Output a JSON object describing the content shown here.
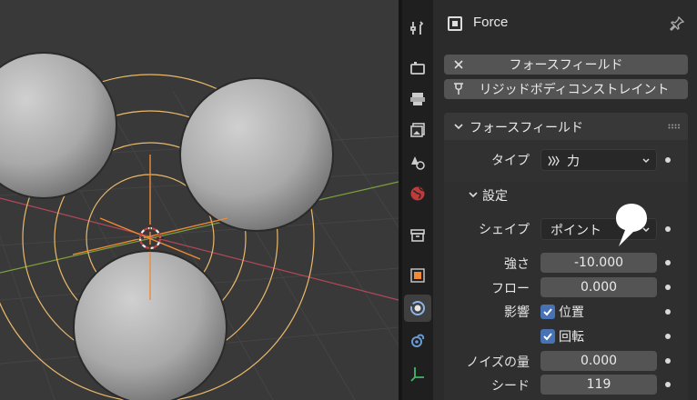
{
  "header": {
    "title": "Force"
  },
  "buttons": {
    "remove_label": "フォースフィールド",
    "rigid_label": "リジッドボディコンストレイント"
  },
  "panel": {
    "title": "フォースフィールド",
    "type_label": "タイプ",
    "type_value": "力",
    "settings_title": "設定",
    "rows": {
      "shape_label": "シェイプ",
      "shape_value": "ポイント",
      "strength_label": "強さ",
      "strength_value": "-10.000",
      "flow_label": "フロー",
      "flow_value": "0.000",
      "affect_label": "影響",
      "affect_location": "位置",
      "affect_rotation": "回転",
      "noise_label": "ノイズの量",
      "noise_value": "0.000",
      "seed_label": "シード",
      "seed_value": "119"
    }
  },
  "tabs": [
    {
      "icon": "tool-icon"
    },
    {
      "icon": "render-icon"
    },
    {
      "icon": "output-icon"
    },
    {
      "icon": "view-layer-icon"
    },
    {
      "icon": "scene-icon"
    },
    {
      "icon": "world-icon"
    },
    {
      "icon": "collection-icon"
    },
    {
      "icon": "object-icon"
    },
    {
      "icon": "physics-icon"
    },
    {
      "icon": "constraints-icon"
    },
    {
      "icon": "object-data-icon"
    }
  ],
  "colors": {
    "accent": "#4772b3",
    "field_gizmo": "#e8b86b",
    "x_axis": "#b3475a",
    "y_axis": "#7aa03e",
    "object_orange": "#f08a34"
  }
}
